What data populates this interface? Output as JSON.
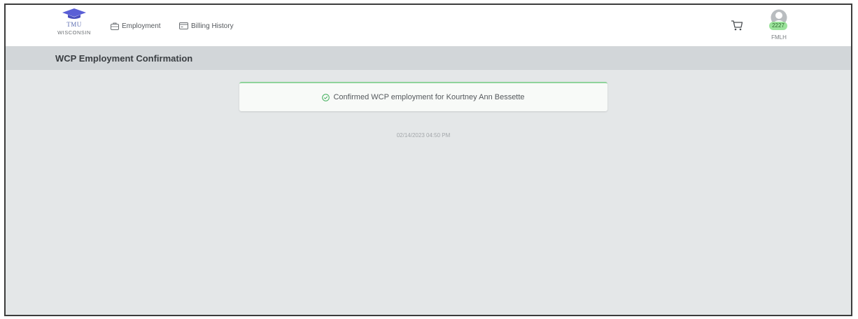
{
  "brand": {
    "abbr": "TMU",
    "state": "WISCONSIN",
    "logo_icon": "graduation-cap-icon",
    "logo_color": "#5a5fd6"
  },
  "nav": {
    "items": [
      {
        "label": "Employment",
        "icon": "briefcase-icon"
      },
      {
        "label": "Billing History",
        "icon": "credit-card-icon"
      }
    ]
  },
  "header": {
    "cart_icon": "cart-icon",
    "user": {
      "icon": "user-avatar-icon",
      "badge": "2227",
      "badge_color": "#9be39b",
      "initials": "FMLH"
    }
  },
  "page": {
    "title": "WCP Employment Confirmation"
  },
  "alert": {
    "icon": "check-circle-icon",
    "accent": "#8fd39b",
    "message": "Confirmed WCP employment for Kourtney Ann Bessette"
  },
  "timestamp": "02/14/2023 04:50 PM"
}
